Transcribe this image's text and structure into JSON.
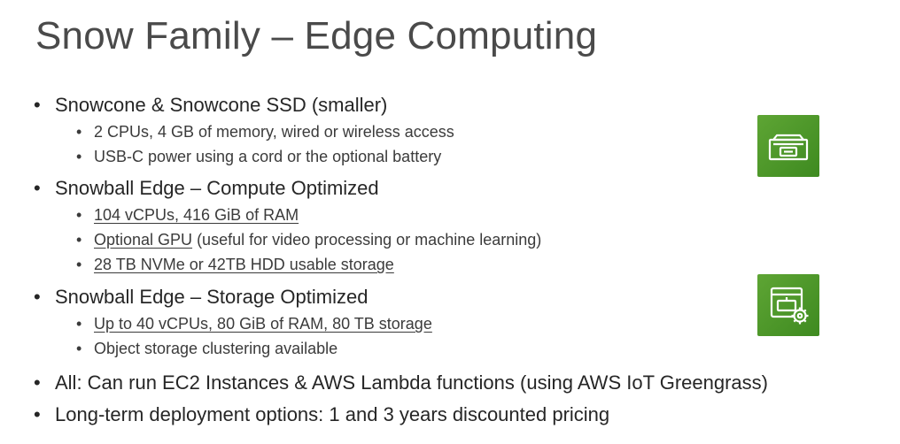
{
  "slide": {
    "title": "Snow Family – Edge Computing",
    "bullet_glyph": "•",
    "items": [
      {
        "text": "Snowcone & Snowcone SSD (smaller)",
        "subitems": [
          {
            "text": "2 CPUs, 4 GB of memory, wired or wireless access"
          },
          {
            "text": "USB-C power using a cord or the optional battery"
          }
        ]
      },
      {
        "text": "Snowball Edge – Compute Optimized",
        "subitems": [
          {
            "text": "104 vCPUs, 416 GiB of RAM"
          },
          {
            "underlined": "Optional GPU",
            "rest": " (useful for video processing or machine learning)"
          },
          {
            "text": "28 TB NVMe or 42TB HDD usable storage"
          }
        ]
      },
      {
        "text": "Snowball Edge – Storage Optimized",
        "subitems": [
          {
            "text": "Up to 40 vCPUs, 80 GiB of RAM, 80 TB storage"
          },
          {
            "text": "Object storage clustering available"
          }
        ]
      },
      {
        "text": "All: Can run EC2 Instances & AWS Lambda functions (using AWS IoT Greengrass)"
      },
      {
        "text": "Long-term deployment options: 1 and 3 years discounted pricing"
      }
    ],
    "icons": [
      {
        "name": "snowcone-icon",
        "color": "#4e9a2a"
      },
      {
        "name": "snowball-edge-icon",
        "color": "#4e9a2a"
      }
    ]
  }
}
